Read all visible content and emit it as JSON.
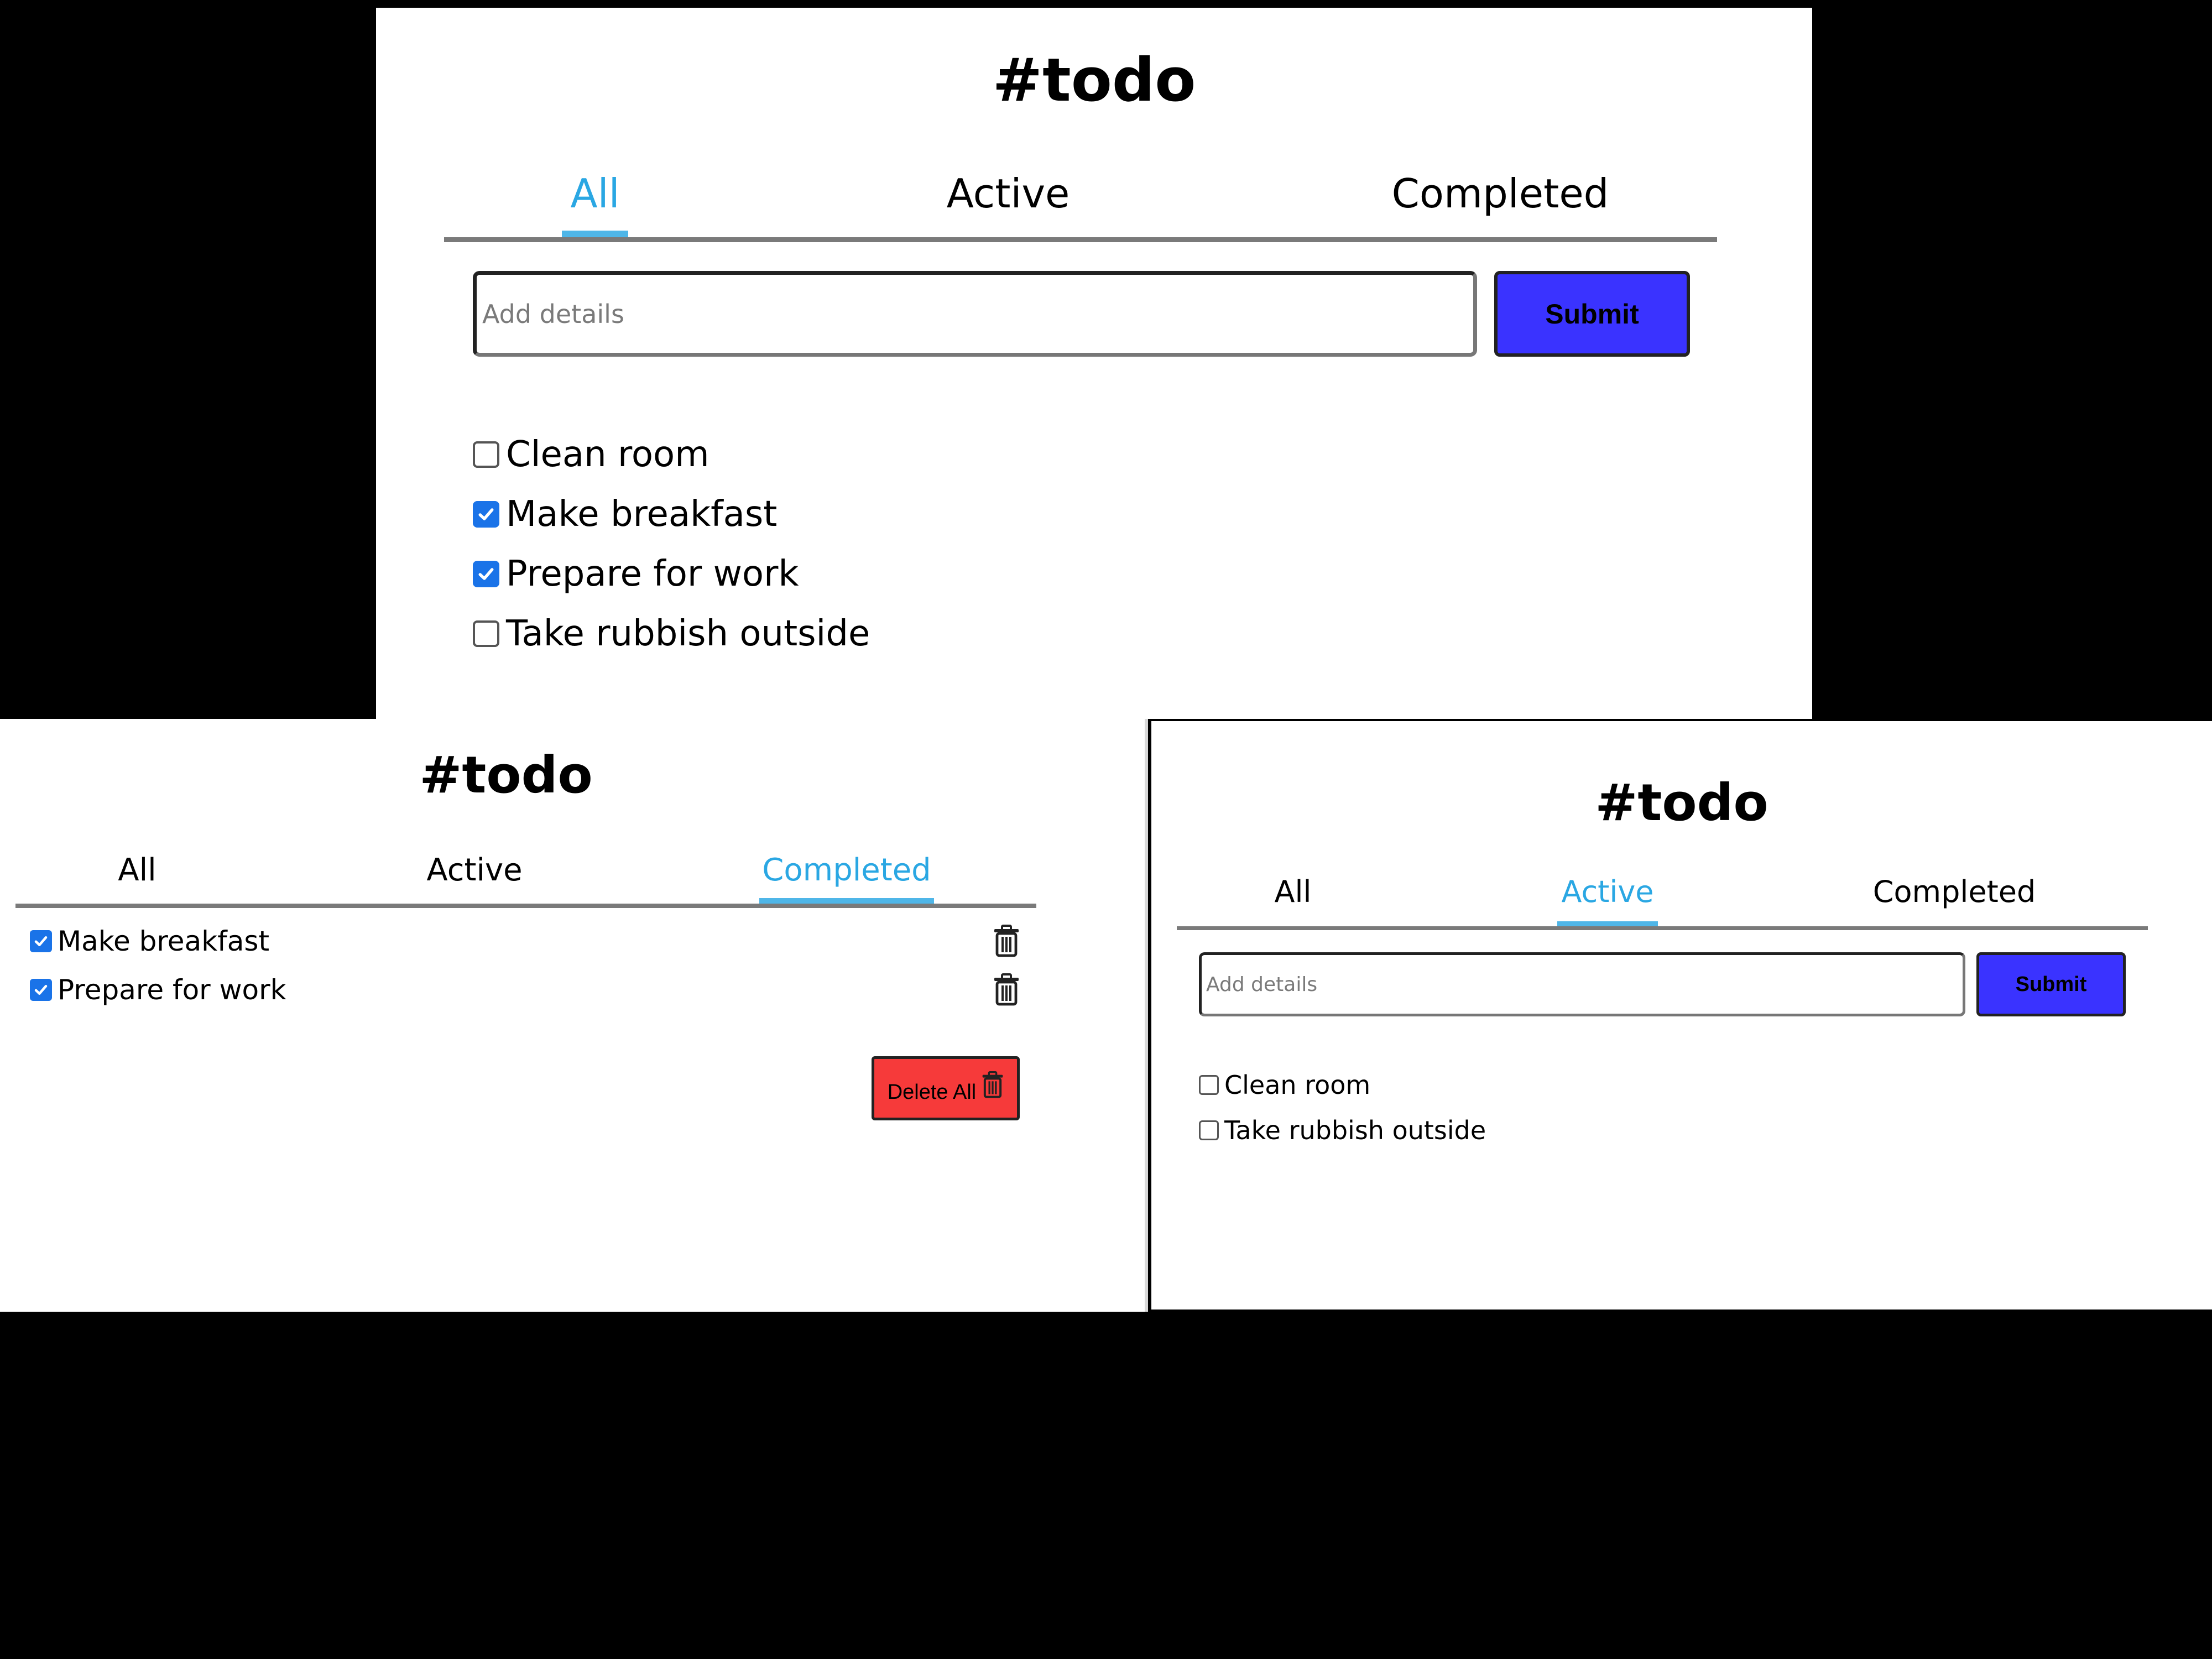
{
  "colors": {
    "active_tab": "#2aa7e3",
    "submit_bg": "#3a33ff",
    "delete_bg": "#f63a3a",
    "checkbox_checked": "#1a73e8",
    "background": "#000000"
  },
  "panel_all": {
    "title": "#todo",
    "tabs": [
      {
        "label": "All",
        "active": true
      },
      {
        "label": "Active",
        "active": false
      },
      {
        "label": "Completed",
        "active": false
      }
    ],
    "input_placeholder": "Add details",
    "submit_label": "Submit",
    "items": [
      {
        "label": "Clean room",
        "checked": false
      },
      {
        "label": "Make breakfast",
        "checked": true
      },
      {
        "label": "Prepare for work",
        "checked": true
      },
      {
        "label": "Take rubbish outside",
        "checked": false
      }
    ]
  },
  "panel_completed": {
    "title": "#todo",
    "tabs": [
      {
        "label": "All",
        "active": false
      },
      {
        "label": "Active",
        "active": false
      },
      {
        "label": "Completed",
        "active": true
      }
    ],
    "items": [
      {
        "label": "Make breakfast",
        "checked": true,
        "icon": "trash-icon"
      },
      {
        "label": "Prepare for work",
        "checked": true,
        "icon": "trash-icon"
      }
    ],
    "delete_all_label": "Delete All",
    "delete_all_icon": "trash-icon"
  },
  "panel_active": {
    "title": "#todo",
    "tabs": [
      {
        "label": "All",
        "active": false
      },
      {
        "label": "Active",
        "active": true
      },
      {
        "label": "Completed",
        "active": false
      }
    ],
    "input_placeholder": "Add details",
    "submit_label": "Submit",
    "items": [
      {
        "label": "Clean room",
        "checked": false
      },
      {
        "label": "Take rubbish outside",
        "checked": false
      }
    ]
  }
}
